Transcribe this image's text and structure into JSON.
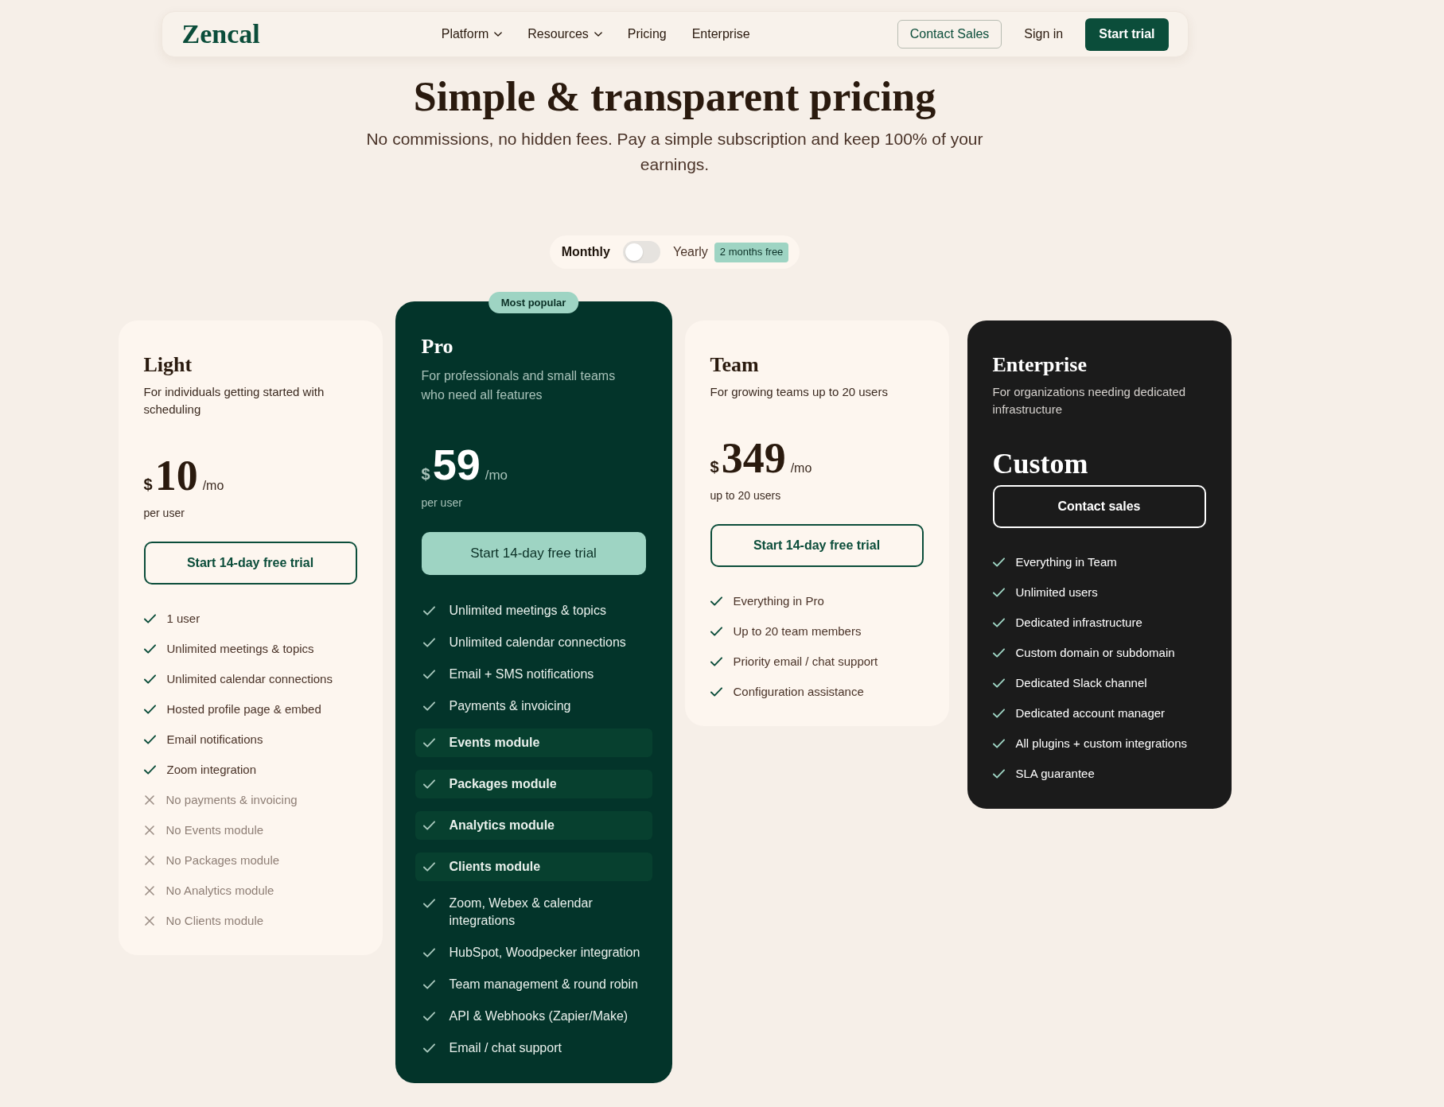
{
  "navbar": {
    "logo": "Zencal",
    "items": [
      {
        "label": "Platform",
        "dropdown": true
      },
      {
        "label": "Resources",
        "dropdown": true
      },
      {
        "label": "Pricing",
        "dropdown": false
      },
      {
        "label": "Enterprise",
        "dropdown": false
      }
    ],
    "actions": [
      {
        "label": "Contact Sales",
        "kind": "outline"
      },
      {
        "label": "Sign in",
        "kind": "text"
      },
      {
        "label": "Start trial",
        "kind": "primary"
      }
    ]
  },
  "hero": {
    "title": "Simple & transparent pricing",
    "subtitle": "No commissions, no hidden fees. Pay a simple subscription and keep 100% of your earnings."
  },
  "billing_toggle": {
    "left_label": "Monthly",
    "on": false,
    "right_label": "Yearly",
    "badge": "2 months free"
  },
  "cards": [
    {
      "kind": "standard",
      "title": "Light",
      "description": "For individuals getting started with scheduling",
      "price": {
        "currency": "$",
        "amount": "10",
        "period": "/mo",
        "note": "per user"
      },
      "button": "Start 14-day free trial",
      "features": [
        {
          "text": "1 user",
          "included": true
        },
        {
          "text": "Unlimited meetings & topics",
          "included": true
        },
        {
          "text": "Unlimited calendar connections",
          "included": true
        },
        {
          "text": "Hosted profile page & embed",
          "included": true
        },
        {
          "text": "Email notifications",
          "included": true
        },
        {
          "text": "Zoom integration",
          "included": true
        },
        {
          "text": "No payments & invoicing",
          "included": false
        },
        {
          "text": "No Events module",
          "included": false
        },
        {
          "text": "No Packages module",
          "included": false
        },
        {
          "text": "No Analytics module",
          "included": false
        },
        {
          "text": "No Clients module",
          "included": false
        }
      ]
    },
    {
      "kind": "featured",
      "badge": "Most popular",
      "title": "Pro",
      "description": "For professionals and small teams who need all features",
      "price": {
        "currency": "$",
        "amount": "59",
        "period": "/mo",
        "note": "per user"
      },
      "button": "Start 14-day free trial",
      "features": [
        {
          "text": "Unlimited meetings & topics",
          "included": true,
          "highlighted": false
        },
        {
          "text": "Unlimited calendar connections",
          "included": true,
          "highlighted": false
        },
        {
          "text": "Email + SMS notifications",
          "included": true,
          "highlighted": false
        },
        {
          "text": "Payments & invoicing",
          "included": true,
          "highlighted": false
        },
        {
          "text": "Events module",
          "included": true,
          "highlighted": true
        },
        {
          "text": "Packages module",
          "included": true,
          "highlighted": true
        },
        {
          "text": "Analytics module",
          "included": true,
          "highlighted": true
        },
        {
          "text": "Clients module",
          "included": true,
          "highlighted": true
        },
        {
          "text": "Zoom, Webex & calendar integrations",
          "included": true,
          "highlighted": false
        },
        {
          "text": "HubSpot, Woodpecker integration",
          "included": true,
          "highlighted": false
        },
        {
          "text": "Team management & round robin",
          "included": true,
          "highlighted": false
        },
        {
          "text": "API & Webhooks (Zapier/Make)",
          "included": true,
          "highlighted": false
        },
        {
          "text": "Email / chat support",
          "included": true,
          "highlighted": false
        }
      ]
    },
    {
      "kind": "standard",
      "title": "Team",
      "description": "For growing teams up to 20 users",
      "price": {
        "currency": "$",
        "amount": "349",
        "period": "/mo",
        "note": "up to 20 users"
      },
      "button": "Start 14-day free trial",
      "features": [
        {
          "text": "Everything in Pro",
          "included": true
        },
        {
          "text": "Up to 20 team members",
          "included": true
        },
        {
          "text": "Priority email / chat support",
          "included": true
        },
        {
          "text": "Configuration assistance",
          "included": true
        }
      ]
    },
    {
      "kind": "dark",
      "title": "Enterprise",
      "description": "For organizations needing dedicated infrastructure",
      "price": {
        "amount": "Custom"
      },
      "button": "Contact sales",
      "features": [
        {
          "text": "Everything in Team",
          "included": true
        },
        {
          "text": "Unlimited users",
          "included": true
        },
        {
          "text": "Dedicated infrastructure",
          "included": true
        },
        {
          "text": "Custom domain or subdomain",
          "included": true
        },
        {
          "text": "Dedicated Slack channel",
          "included": true
        },
        {
          "text": "Dedicated account manager",
          "included": true
        },
        {
          "text": "All plugins + custom integrations",
          "included": true
        },
        {
          "text": "SLA guarantee",
          "included": true
        }
      ]
    }
  ]
}
